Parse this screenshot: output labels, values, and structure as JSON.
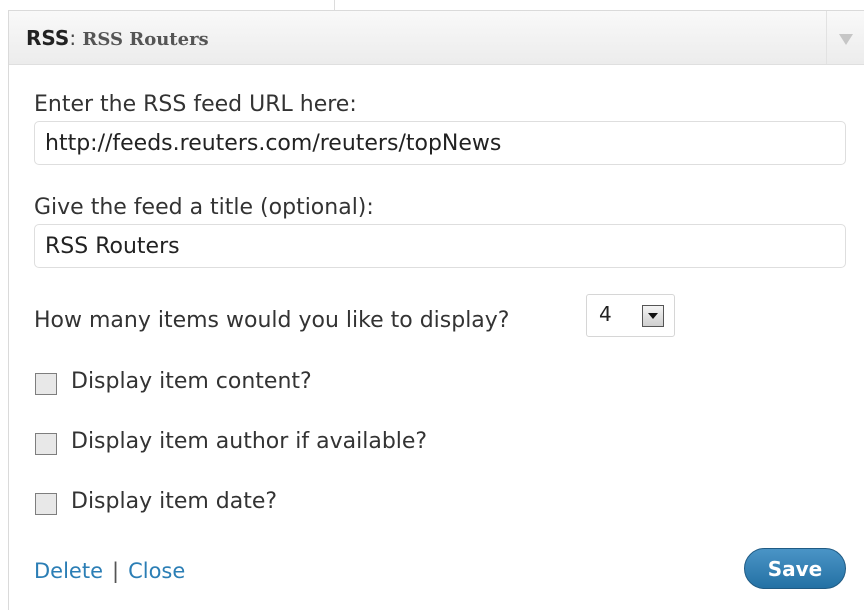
{
  "header": {
    "prefix": "RSS",
    "separator": ": ",
    "widget_title": "RSS Routers"
  },
  "form": {
    "feed_url": {
      "label": "Enter the RSS feed URL here:",
      "value": "http://feeds.reuters.com/reuters/topNews"
    },
    "feed_title": {
      "label": "Give the feed a title (optional):",
      "value": "RSS Routers"
    },
    "items_count": {
      "label": "How many items would you like to display?",
      "selected": "4"
    },
    "options": [
      {
        "label": "Display item content?",
        "checked": false
      },
      {
        "label": "Display item author if available?",
        "checked": false
      },
      {
        "label": "Display item date?",
        "checked": false
      }
    ]
  },
  "footer": {
    "delete_label": "Delete",
    "divider": "|",
    "close_label": "Close",
    "save_label": "Save"
  },
  "colors": {
    "link": "#2b7eb5",
    "save_button": "#2471a4"
  },
  "icons": {
    "collapse_toggle": "triangle-down-icon",
    "dropdown": "chevron-down-icon"
  }
}
